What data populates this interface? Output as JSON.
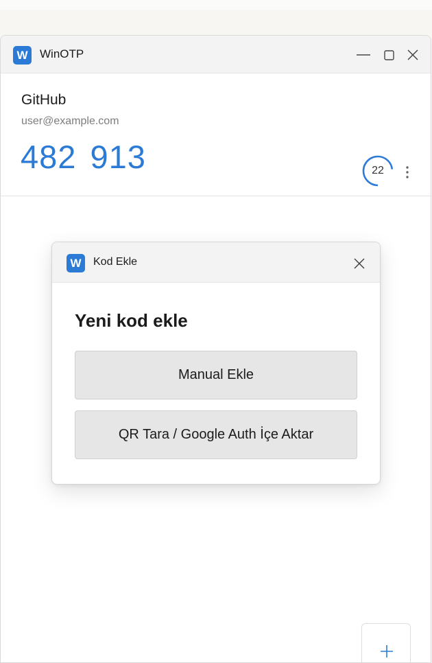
{
  "window": {
    "title": "WinOTP",
    "logo_letter": "W"
  },
  "entry": {
    "service": "GitHub",
    "account": "user@example.com",
    "code": "482 913",
    "seconds_remaining": "22",
    "timer_fraction_remaining": 0.73
  },
  "dialog": {
    "title": "Kod Ekle",
    "logo_letter": "W",
    "heading": "Yeni kod ekle",
    "manual_label": "Manual Ekle",
    "qr_label": "QR Tara / Google Auth İçe Aktar"
  },
  "icons": {
    "minimize": "minimize-icon",
    "maximize": "maximize-icon",
    "close": "close-icon",
    "more": "more-vertical-icon",
    "add": "plus-icon"
  },
  "colors": {
    "accent": "#2b7bd6",
    "button_bg": "#e6e6e6",
    "titlebar_bg": "#f3f3f3"
  }
}
